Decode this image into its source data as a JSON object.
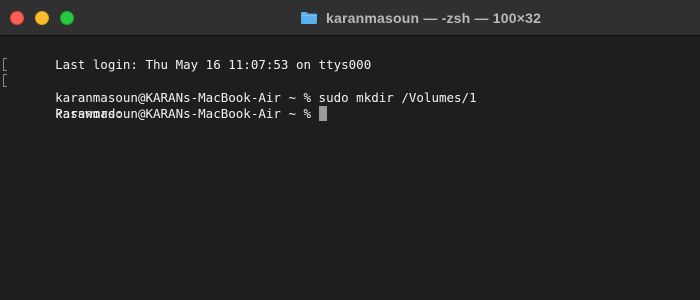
{
  "window": {
    "title": "karanmasoun — -zsh — 100×32"
  },
  "terminal": {
    "lines": [
      {
        "text": "Last login: Thu May 16 11:07:53 on ttys000"
      },
      {
        "text": "karanmasoun@KARANs-MacBook-Air ~ % sudo mkdir /Volumes/1"
      },
      {
        "text": "Password:"
      },
      {
        "text": "karanmasoun@KARANs-MacBook-Air ~ % "
      }
    ]
  },
  "colors": {
    "background": "#1e1e1e",
    "titlebar": "#303030",
    "text": "#f2f2f2",
    "close": "#fe5f57",
    "minimize": "#febc2e",
    "maximize": "#28c840",
    "folder": "#5ab0ef",
    "cursor": "#9a9a9a"
  },
  "icons": {
    "title_icon": "folder-icon"
  }
}
